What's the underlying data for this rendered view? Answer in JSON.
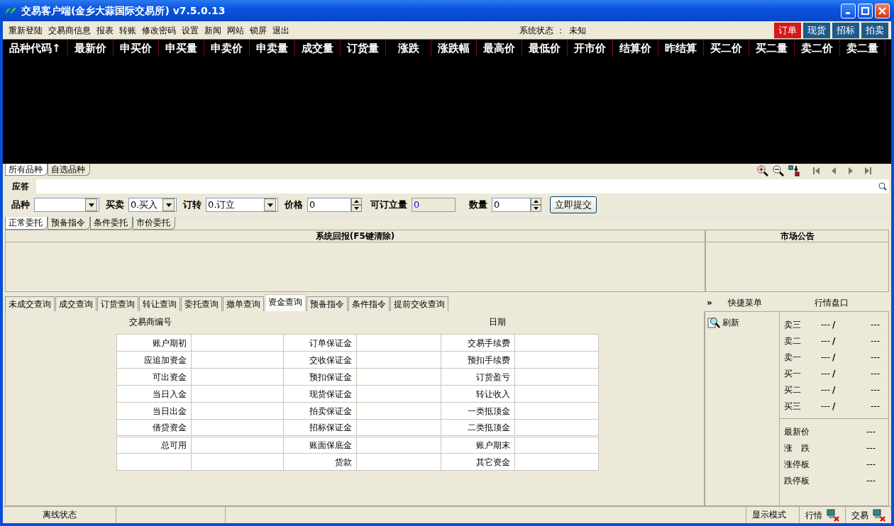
{
  "window": {
    "title": "交易客户端(金乡大蒜国际交易所) v7.5.0.13"
  },
  "menu": [
    "重新登陆",
    "交易商信息",
    "报表",
    "转账",
    "修改密码",
    "设置",
    "新闻",
    "网站",
    "锁屏",
    "退出"
  ],
  "system_status": {
    "label": "系统状态 ：",
    "value": "未知"
  },
  "market_buttons": [
    {
      "label": "订单",
      "selected": true
    },
    {
      "label": "现货",
      "selected": false
    },
    {
      "label": "招标",
      "selected": false
    },
    {
      "label": "拍卖",
      "selected": false
    }
  ],
  "quote_table": {
    "columns": [
      "品种代码↑",
      "最新价",
      "申买价",
      "申买量",
      "申卖价",
      "申卖量",
      "成交量",
      "订货量",
      "涨跌",
      "涨跌幅",
      "最高价",
      "最低价",
      "开市价",
      "结算价",
      "昨结算",
      "买二价",
      "买二量",
      "卖二价",
      "卖二量"
    ]
  },
  "quote_tabs": [
    {
      "label": "所有品种",
      "selected": true
    },
    {
      "label": "自选品种",
      "selected": false
    }
  ],
  "response": {
    "label": "应答"
  },
  "order_form": {
    "fields": [
      {
        "label": "品种",
        "kind": "combo"
      },
      {
        "label": "买卖",
        "kind": "combo",
        "value": "0.买入"
      },
      {
        "label": "订转",
        "kind": "combo",
        "value": "0.订立"
      },
      {
        "label": "价格",
        "kind": "spin",
        "value": "0"
      },
      {
        "label": "可订立量",
        "kind": "readonly",
        "value": "0"
      },
      {
        "label": "数量",
        "kind": "spin",
        "value": "0"
      }
    ],
    "submit": "立即提交"
  },
  "entrust_tabs": [
    {
      "label": "正常委托",
      "selected": true
    },
    {
      "label": "预备指令",
      "selected": false
    },
    {
      "label": "条件委托",
      "selected": false
    },
    {
      "label": "市价委托",
      "selected": false
    }
  ],
  "report_panel": {
    "title": "系统回报(F5键清除)"
  },
  "announcement_panel": {
    "title": "市场公告"
  },
  "query_tabs": [
    {
      "label": "未成交查询",
      "selected": false
    },
    {
      "label": "成交查询",
      "selected": false
    },
    {
      "label": "订货查询",
      "selected": false
    },
    {
      "label": "转让查询",
      "selected": false
    },
    {
      "label": "委托查询",
      "selected": false
    },
    {
      "label": "撤单查询",
      "selected": false
    },
    {
      "label": "资金查询",
      "selected": true
    },
    {
      "label": "预备指令",
      "selected": false
    },
    {
      "label": "条件指令",
      "selected": false
    },
    {
      "label": "提前交收查询",
      "selected": false
    }
  ],
  "funds": {
    "broker_label": "交易商编号",
    "date_label": "日期",
    "sections": [
      [
        {
          "column_1": "账户期初",
          "column_2": "订单保证金",
          "column_3": "交易手续费"
        },
        {
          "column_1": "应追加资金",
          "column_2": "交收保证金",
          "column_3": "预扣手续费"
        },
        {
          "column_1": "可出资金",
          "column_2": "预扣保证金",
          "column_3": "订货盈亏"
        },
        {
          "column_1": "当日入金",
          "column_2": "现货保证金",
          "column_3": "转让收入"
        },
        {
          "column_1": "当日出金",
          "column_2": "拍卖保证金",
          "column_3": "一类抵顶金"
        },
        {
          "column_1": "借贷资金",
          "column_2": "招标保证金",
          "column_3": "二类抵顶金"
        }
      ],
      [
        {
          "column_1": "总可用",
          "column_2": "账面保底金",
          "column_3": "账户期末"
        },
        {
          "column_2": "货款",
          "column_3": "其它资金"
        }
      ]
    ]
  },
  "quick_menu": {
    "toggle": "»",
    "title": "快捷菜单",
    "items": [
      {
        "label": "刷新"
      }
    ]
  },
  "order_book": {
    "title": "行情盘口",
    "levels": [
      {
        "label": "卖三",
        "price": "---",
        "divider": "/",
        "volume": "---"
      },
      {
        "label": "卖二",
        "price": "---",
        "divider": "/",
        "volume": "---"
      },
      {
        "label": "卖一",
        "price": "---",
        "divider": "/",
        "volume": "---"
      },
      {
        "label": "买一",
        "price": "---",
        "divider": "/",
        "volume": "---"
      },
      {
        "label": "买二",
        "price": "---",
        "divider": "/",
        "volume": "---"
      },
      {
        "label": "买三",
        "price": "---",
        "divider": "/",
        "volume": "---"
      }
    ],
    "stats": [
      {
        "label": "最新价",
        "value": "---"
      },
      {
        "label": "涨　跌",
        "value": "---"
      },
      {
        "label": "涨停板",
        "value": "---"
      },
      {
        "label": "跌停板",
        "value": "---"
      }
    ]
  },
  "status_bar": {
    "connection": "离线状态",
    "display_mode": "显示模式",
    "links": [
      {
        "label": "行情",
        "connected": false
      },
      {
        "label": "交易",
        "connected": false
      }
    ]
  }
}
